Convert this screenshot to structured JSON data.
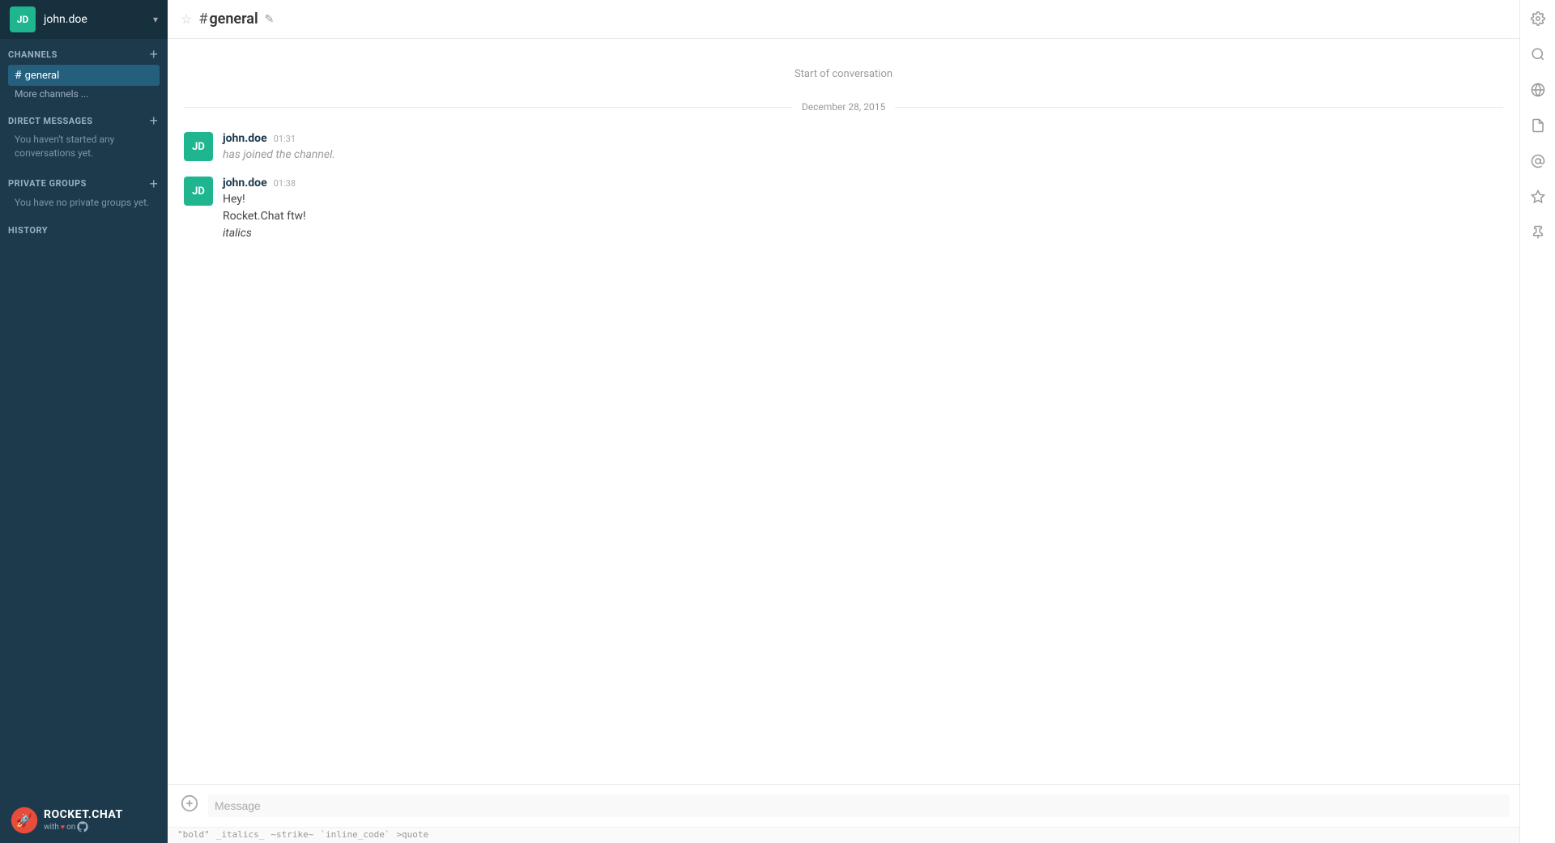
{
  "sidebar": {
    "user": {
      "initials": "JD",
      "username": "john.doe"
    },
    "channels_section": {
      "title": "CHANNELS",
      "add_label": "+",
      "items": [
        {
          "name": "general",
          "active": true
        }
      ],
      "more_channels_label": "More channels ..."
    },
    "direct_messages_section": {
      "title": "DIRECT MESSAGES",
      "add_label": "+",
      "empty_message": "You haven't started any conversations yet."
    },
    "private_groups_section": {
      "title": "PRIVATE GROUPS",
      "add_label": "+",
      "empty_message": "You have no private groups yet."
    },
    "history": {
      "label": "HISTORY"
    },
    "footer": {
      "brand": "ROCKET.CHAT",
      "sub_with": "with",
      "sub_heart": "♥",
      "sub_on": "on",
      "sub_github": "GitHub"
    }
  },
  "topbar": {
    "channel_name": "general",
    "star_icon": "☆",
    "hash_icon": "#",
    "edit_icon": "✎"
  },
  "messages": {
    "start_label": "Start of conversation",
    "date_divider": "December 28, 2015",
    "items": [
      {
        "avatar_initials": "JD",
        "username": "john.doe",
        "time": "01:31",
        "text": "has joined the channel.",
        "system": true
      },
      {
        "avatar_initials": "JD",
        "username": "john.doe",
        "time": "01:38",
        "lines": [
          "Hey!",
          "Rocket.Chat ftw!",
          "italics"
        ],
        "italic_lines": [
          false,
          false,
          true
        ],
        "system": false
      }
    ]
  },
  "input": {
    "placeholder": "Message",
    "attach_icon": "⊕"
  },
  "format_hints": [
    {
      "label": "\"bold\""
    },
    {
      "label": "_italics_"
    },
    {
      "label": "~strike~"
    },
    {
      "label": "`inline_code`"
    },
    {
      "label": ">quote"
    }
  ],
  "right_toolbar": {
    "icons": [
      {
        "name": "gear-icon",
        "symbol": "⚙"
      },
      {
        "name": "search-icon",
        "symbol": "🔍"
      },
      {
        "name": "globe-icon",
        "symbol": "🌐"
      },
      {
        "name": "file-icon",
        "symbol": "📄"
      },
      {
        "name": "at-icon",
        "symbol": "@"
      },
      {
        "name": "star-icon",
        "symbol": "★"
      },
      {
        "name": "pin-icon",
        "symbol": "📌"
      }
    ]
  }
}
